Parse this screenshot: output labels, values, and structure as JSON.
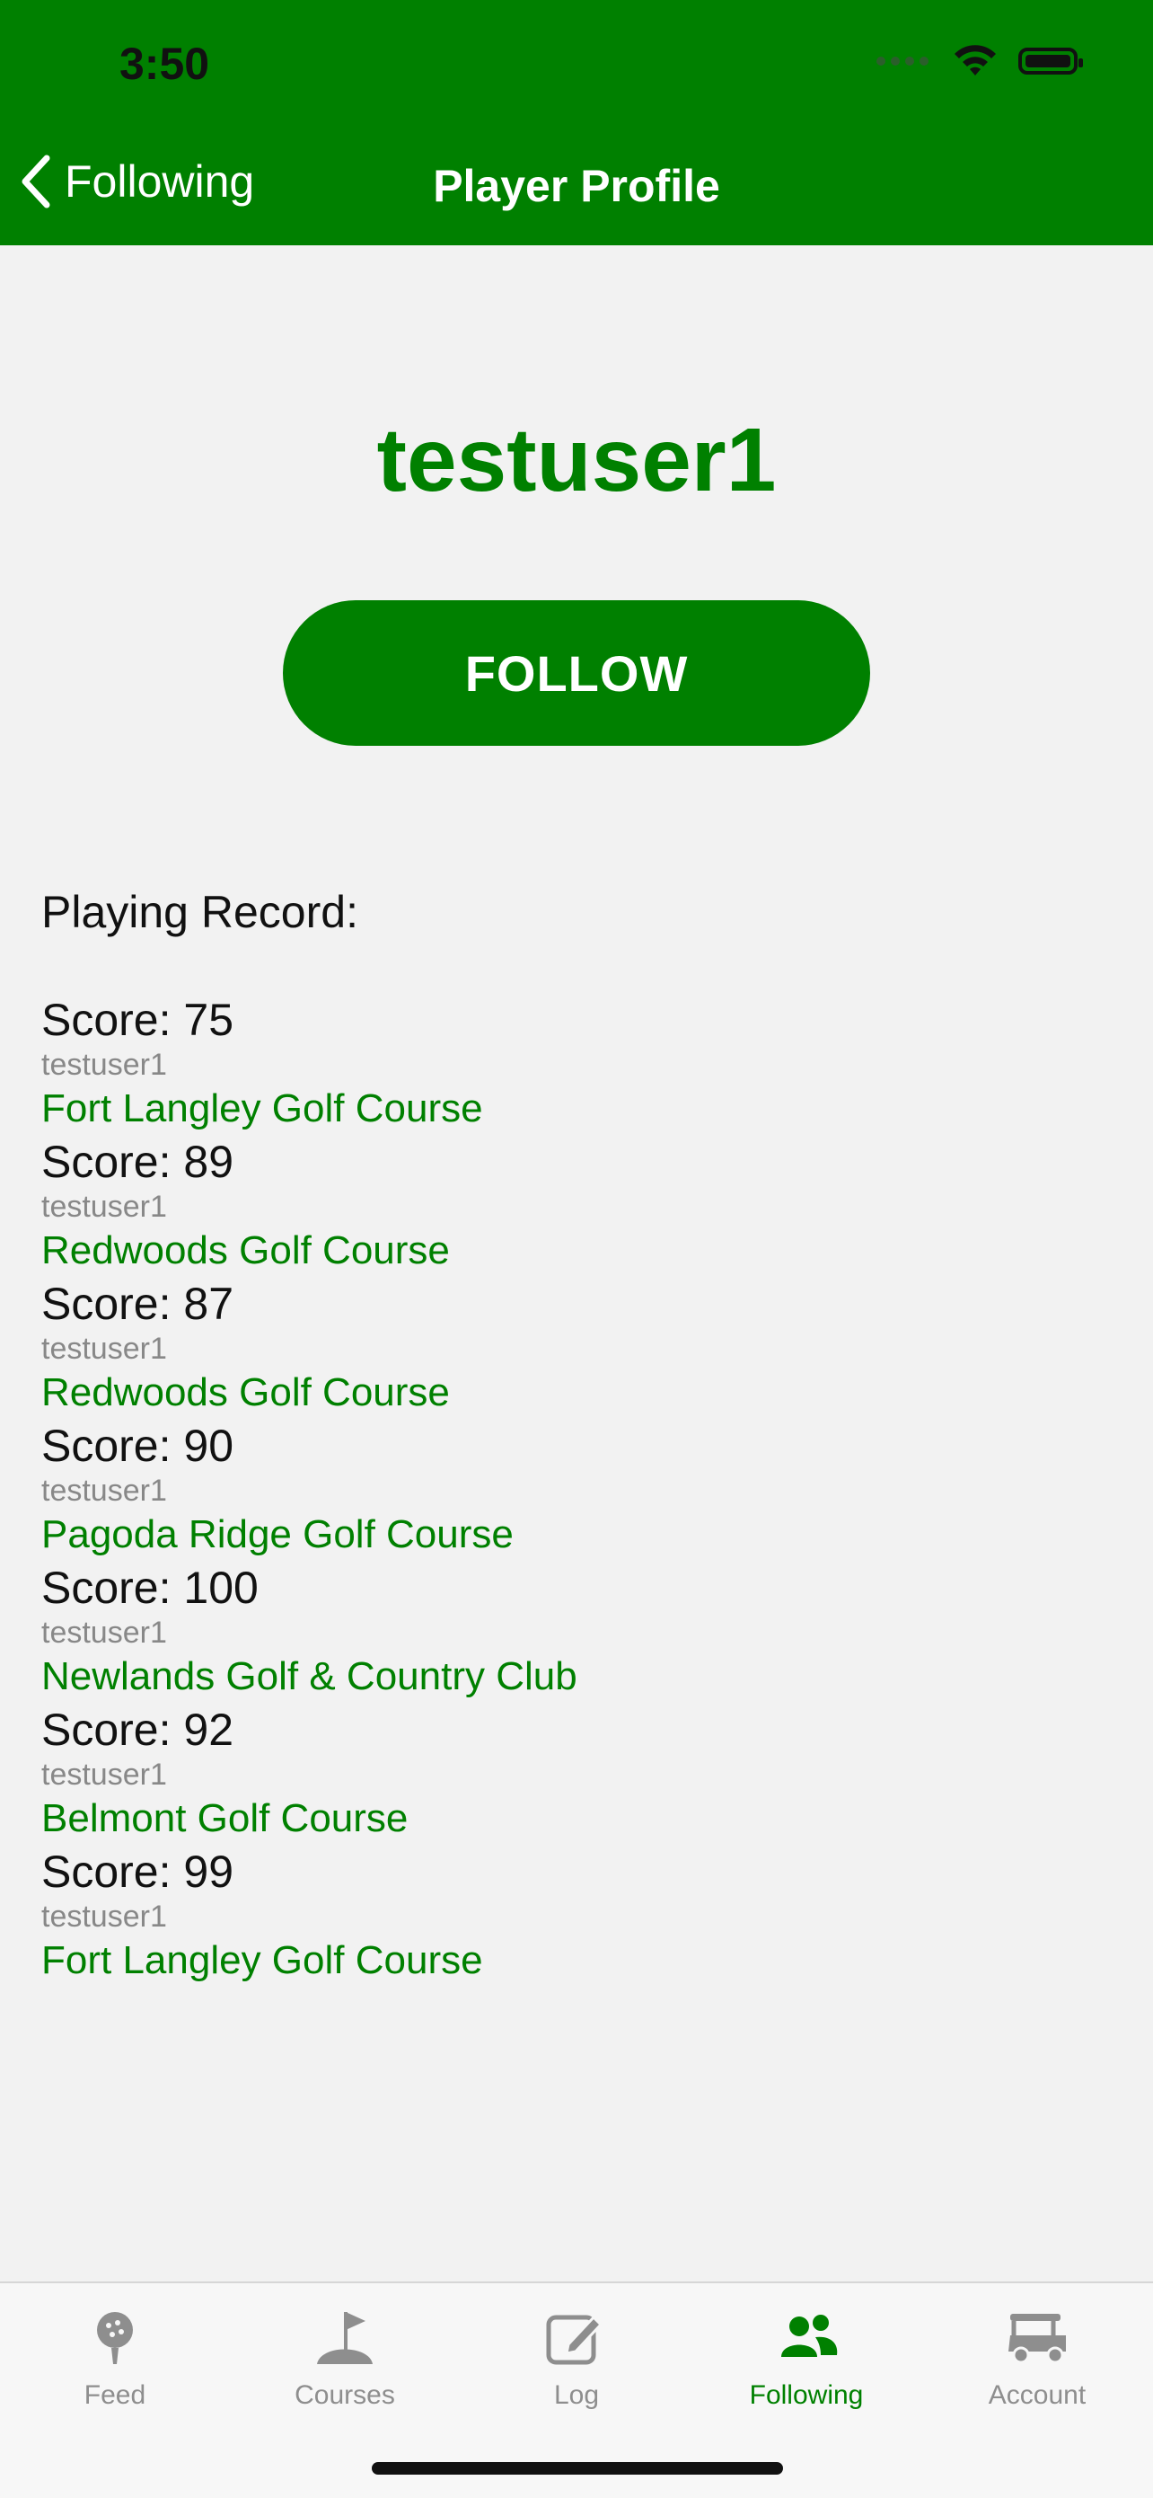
{
  "status_bar": {
    "time": "3:50"
  },
  "nav": {
    "back_label": "Following",
    "title": "Player Profile"
  },
  "profile": {
    "username": "testuser1",
    "follow_label": "FOLLOW"
  },
  "record": {
    "heading": "Playing Record:",
    "entries": [
      {
        "score": "Score: 75",
        "player": "testuser1",
        "course": "Fort Langley Golf Course"
      },
      {
        "score": "Score: 89",
        "player": "testuser1",
        "course": "Redwoods Golf Course"
      },
      {
        "score": "Score: 87",
        "player": "testuser1",
        "course": "Redwoods Golf Course"
      },
      {
        "score": "Score: 90",
        "player": "testuser1",
        "course": "Pagoda Ridge Golf Course"
      },
      {
        "score": "Score: 100",
        "player": "testuser1",
        "course": "Newlands Golf & Country Club"
      },
      {
        "score": "Score: 92",
        "player": "testuser1",
        "course": "Belmont Golf Course"
      },
      {
        "score": "Score: 99",
        "player": "testuser1",
        "course": "Fort Langley Golf Course"
      }
    ]
  },
  "tabs": [
    {
      "label": "Feed",
      "icon": "golf-ball-tee-icon",
      "active": false
    },
    {
      "label": "Courses",
      "icon": "flag-icon",
      "active": false
    },
    {
      "label": "Log",
      "icon": "edit-icon",
      "active": false
    },
    {
      "label": "Following",
      "icon": "users-icon",
      "active": true
    },
    {
      "label": "Account",
      "icon": "golf-cart-icon",
      "active": false
    }
  ],
  "colors": {
    "brand_green": "#008000",
    "background": "#f2f2f2",
    "muted_text": "#888888"
  }
}
